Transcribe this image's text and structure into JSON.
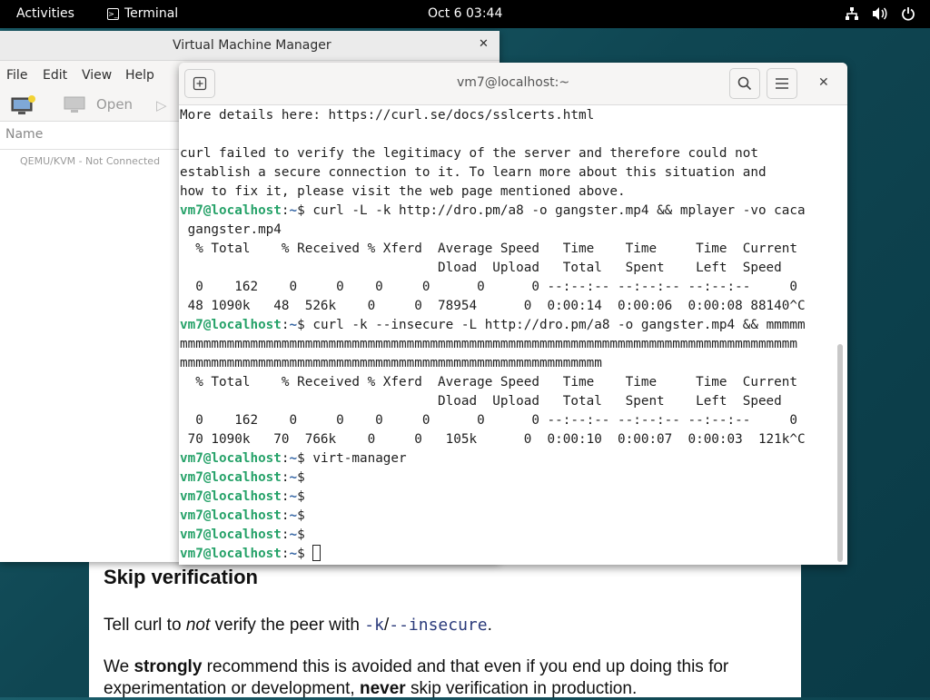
{
  "topbar": {
    "activities": "Activities",
    "app_name": "Terminal",
    "clock": "Oct 6  03:44",
    "tray_icons": [
      "network-icon",
      "volume-icon",
      "power-icon"
    ]
  },
  "webpage": {
    "heading": "Skip verification",
    "p1_a": "Tell curl to ",
    "p1_em": "not",
    "p1_b": " verify the peer with ",
    "p1_code1": "-k",
    "p1_slash": "/",
    "p1_code2": "--insecure",
    "p1_end": ".",
    "p2_a": "We ",
    "p2_strong": "strongly",
    "p2_b": " recommend this is avoided and that even if you end up doing this for experimentation or development, ",
    "p2_strong2": "never",
    "p2_c": " skip verification in production."
  },
  "vmm": {
    "title": "Virtual Machine Manager",
    "menu": [
      "File",
      "Edit",
      "View",
      "Help"
    ],
    "open_label": "Open",
    "column_name": "Name",
    "connection": "QEMU/KVM - Not Connected"
  },
  "terminal": {
    "title": "vm7@localhost:~",
    "lines": [
      {
        "type": "text",
        "text": "More details here: https://curl.se/docs/sslcerts.html"
      },
      {
        "type": "text",
        "text": ""
      },
      {
        "type": "text",
        "text": "curl failed to verify the legitimacy of the server and therefore could not"
      },
      {
        "type": "text",
        "text": "establish a secure connection to it. To learn more about this situation and"
      },
      {
        "type": "text",
        "text": "how to fix it, please visit the web page mentioned above."
      },
      {
        "type": "prompt",
        "user": "vm7@localhost",
        "path": "~",
        "cmd": " curl -L -k http://dro.pm/a8 -o gangster.mp4 && mplayer -vo caca"
      },
      {
        "type": "text",
        "text": " gangster.mp4"
      },
      {
        "type": "text",
        "text": "  % Total    % Received % Xferd  Average Speed   Time    Time     Time  Current"
      },
      {
        "type": "text",
        "text": "                                 Dload  Upload   Total   Spent    Left  Speed"
      },
      {
        "type": "text",
        "text": "  0    162    0     0    0     0      0      0 --:--:-- --:--:-- --:--:--     0"
      },
      {
        "type": "text",
        "text": " 48 1090k   48  526k    0     0  78954      0  0:00:14  0:00:06  0:00:08 88140^C"
      },
      {
        "type": "prompt",
        "user": "vm7@localhost",
        "path": "~",
        "cmd": " curl -k --insecure -L http://dro.pm/a8 -o gangster.mp4 && mmmmm"
      },
      {
        "type": "text",
        "text": "mmmmmmmmmmmmmmmmmmmmmmmmmmmmmmmmmmmmmmmmmmmmmmmmmmmmmmmmmmmmmmmmmmmmmmmmmmmmmmm"
      },
      {
        "type": "text",
        "text": "mmmmmmmmmmmmmmmmmmmmmmmmmmmmmmmmmmmmmmmmmmmmmmmmmmmmmm"
      },
      {
        "type": "text",
        "text": "  % Total    % Received % Xferd  Average Speed   Time    Time     Time  Current"
      },
      {
        "type": "text",
        "text": "                                 Dload  Upload   Total   Spent    Left  Speed"
      },
      {
        "type": "text",
        "text": "  0    162    0     0    0     0      0      0 --:--:-- --:--:-- --:--:--     0"
      },
      {
        "type": "text",
        "text": " 70 1090k   70  766k    0     0   105k      0  0:00:10  0:00:07  0:00:03  121k^C"
      },
      {
        "type": "prompt",
        "user": "vm7@localhost",
        "path": "~",
        "cmd": " virt-manager"
      },
      {
        "type": "prompt",
        "user": "vm7@localhost",
        "path": "~",
        "cmd": ""
      },
      {
        "type": "prompt",
        "user": "vm7@localhost",
        "path": "~",
        "cmd": ""
      },
      {
        "type": "prompt",
        "user": "vm7@localhost",
        "path": "~",
        "cmd": ""
      },
      {
        "type": "prompt",
        "user": "vm7@localhost",
        "path": "~",
        "cmd": ""
      },
      {
        "type": "prompt",
        "user": "vm7@localhost",
        "path": "~",
        "cmd": " ",
        "cursor": true
      }
    ]
  }
}
